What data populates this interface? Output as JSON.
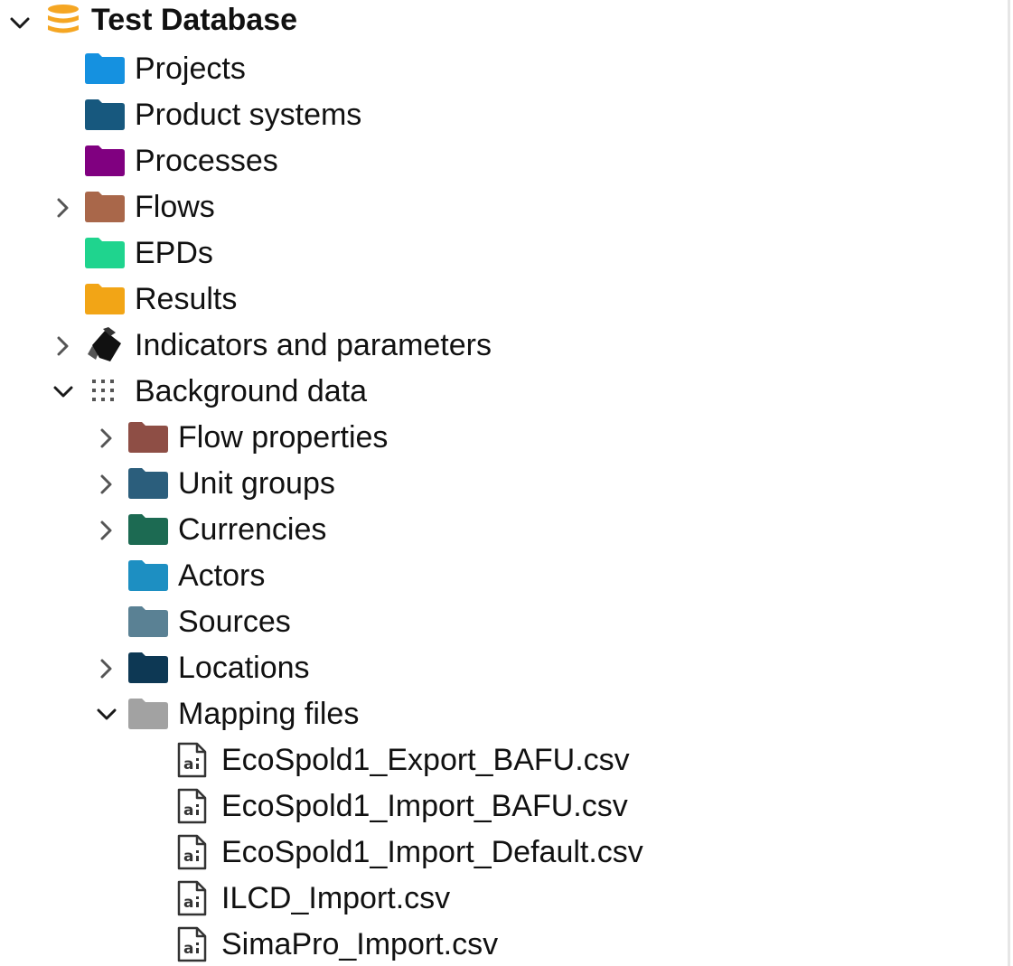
{
  "root": {
    "label": "Test Database",
    "expanded": true,
    "icon": "database-icon",
    "color": "#f5a623"
  },
  "top_items": [
    {
      "label": "Projects",
      "icon": "folder-icon",
      "color": "#1591e0"
    },
    {
      "label": "Product systems",
      "icon": "folder-icon",
      "color": "#17587e"
    },
    {
      "label": "Processes",
      "icon": "folder-icon",
      "color": "#800080"
    },
    {
      "label": "Flows",
      "icon": "folder-icon",
      "color": "#a9674a",
      "expandable": true
    },
    {
      "label": "EPDs",
      "icon": "folder-icon",
      "color": "#1fd48e"
    },
    {
      "label": "Results",
      "icon": "folder-icon",
      "color": "#f2a516"
    },
    {
      "label": "Indicators and parameters",
      "icon": "indicators-icon",
      "color": "#111111",
      "expandable": true
    }
  ],
  "background": {
    "label": "Background data",
    "icon": "grid-dots-icon",
    "expanded": true,
    "items": [
      {
        "label": "Flow properties",
        "icon": "folder-icon",
        "color": "#8e4e45",
        "expandable": true
      },
      {
        "label": "Unit groups",
        "icon": "folder-icon",
        "color": "#2b5e7c",
        "expandable": true
      },
      {
        "label": "Currencies",
        "icon": "folder-icon",
        "color": "#1c6a52",
        "expandable": true
      },
      {
        "label": "Actors",
        "icon": "folder-icon",
        "color": "#1d8fc2"
      },
      {
        "label": "Sources",
        "icon": "folder-icon",
        "color": "#5a8194"
      },
      {
        "label": "Locations",
        "icon": "folder-icon",
        "color": "#0d3854",
        "expandable": true
      },
      {
        "label": "Mapping files",
        "icon": "folder-icon",
        "color": "#a2a2a2",
        "expanded": true
      }
    ]
  },
  "mapping_files": [
    {
      "label": "EcoSpold1_Export_BAFU.csv",
      "icon": "file-icon"
    },
    {
      "label": "EcoSpold1_Import_BAFU.csv",
      "icon": "file-icon"
    },
    {
      "label": "EcoSpold1_Import_Default.csv",
      "icon": "file-icon"
    },
    {
      "label": "ILCD_Import.csv",
      "icon": "file-icon"
    },
    {
      "label": "SimaPro_Import.csv",
      "icon": "file-icon"
    }
  ]
}
